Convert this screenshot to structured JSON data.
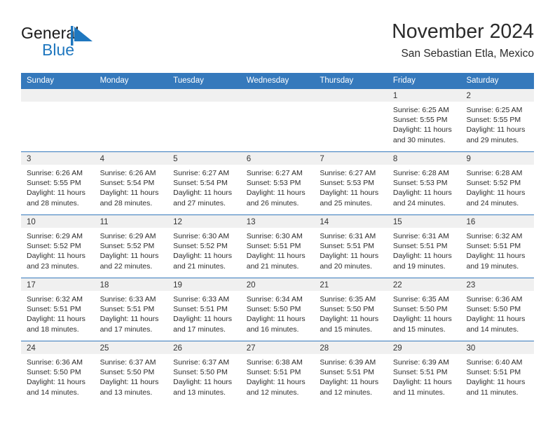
{
  "brand": {
    "name_part1": "General",
    "name_part2": "Blue",
    "accent_color": "#1f77bf"
  },
  "header": {
    "month_title": "November 2024",
    "location": "San Sebastian Etla, Mexico"
  },
  "calendar": {
    "header_color": "#3579bc",
    "weekdays": [
      "Sunday",
      "Monday",
      "Tuesday",
      "Wednesday",
      "Thursday",
      "Friday",
      "Saturday"
    ],
    "weeks": [
      [
        {
          "day": "",
          "sunrise": "",
          "sunset": "",
          "daylight": "",
          "daylight2": ""
        },
        {
          "day": "",
          "sunrise": "",
          "sunset": "",
          "daylight": "",
          "daylight2": ""
        },
        {
          "day": "",
          "sunrise": "",
          "sunset": "",
          "daylight": "",
          "daylight2": ""
        },
        {
          "day": "",
          "sunrise": "",
          "sunset": "",
          "daylight": "",
          "daylight2": ""
        },
        {
          "day": "",
          "sunrise": "",
          "sunset": "",
          "daylight": "",
          "daylight2": ""
        },
        {
          "day": "1",
          "sunrise": "Sunrise: 6:25 AM",
          "sunset": "Sunset: 5:55 PM",
          "daylight": "Daylight: 11 hours",
          "daylight2": "and 30 minutes."
        },
        {
          "day": "2",
          "sunrise": "Sunrise: 6:25 AM",
          "sunset": "Sunset: 5:55 PM",
          "daylight": "Daylight: 11 hours",
          "daylight2": "and 29 minutes."
        }
      ],
      [
        {
          "day": "3",
          "sunrise": "Sunrise: 6:26 AM",
          "sunset": "Sunset: 5:55 PM",
          "daylight": "Daylight: 11 hours",
          "daylight2": "and 28 minutes."
        },
        {
          "day": "4",
          "sunrise": "Sunrise: 6:26 AM",
          "sunset": "Sunset: 5:54 PM",
          "daylight": "Daylight: 11 hours",
          "daylight2": "and 28 minutes."
        },
        {
          "day": "5",
          "sunrise": "Sunrise: 6:27 AM",
          "sunset": "Sunset: 5:54 PM",
          "daylight": "Daylight: 11 hours",
          "daylight2": "and 27 minutes."
        },
        {
          "day": "6",
          "sunrise": "Sunrise: 6:27 AM",
          "sunset": "Sunset: 5:53 PM",
          "daylight": "Daylight: 11 hours",
          "daylight2": "and 26 minutes."
        },
        {
          "day": "7",
          "sunrise": "Sunrise: 6:27 AM",
          "sunset": "Sunset: 5:53 PM",
          "daylight": "Daylight: 11 hours",
          "daylight2": "and 25 minutes."
        },
        {
          "day": "8",
          "sunrise": "Sunrise: 6:28 AM",
          "sunset": "Sunset: 5:53 PM",
          "daylight": "Daylight: 11 hours",
          "daylight2": "and 24 minutes."
        },
        {
          "day": "9",
          "sunrise": "Sunrise: 6:28 AM",
          "sunset": "Sunset: 5:52 PM",
          "daylight": "Daylight: 11 hours",
          "daylight2": "and 24 minutes."
        }
      ],
      [
        {
          "day": "10",
          "sunrise": "Sunrise: 6:29 AM",
          "sunset": "Sunset: 5:52 PM",
          "daylight": "Daylight: 11 hours",
          "daylight2": "and 23 minutes."
        },
        {
          "day": "11",
          "sunrise": "Sunrise: 6:29 AM",
          "sunset": "Sunset: 5:52 PM",
          "daylight": "Daylight: 11 hours",
          "daylight2": "and 22 minutes."
        },
        {
          "day": "12",
          "sunrise": "Sunrise: 6:30 AM",
          "sunset": "Sunset: 5:52 PM",
          "daylight": "Daylight: 11 hours",
          "daylight2": "and 21 minutes."
        },
        {
          "day": "13",
          "sunrise": "Sunrise: 6:30 AM",
          "sunset": "Sunset: 5:51 PM",
          "daylight": "Daylight: 11 hours",
          "daylight2": "and 21 minutes."
        },
        {
          "day": "14",
          "sunrise": "Sunrise: 6:31 AM",
          "sunset": "Sunset: 5:51 PM",
          "daylight": "Daylight: 11 hours",
          "daylight2": "and 20 minutes."
        },
        {
          "day": "15",
          "sunrise": "Sunrise: 6:31 AM",
          "sunset": "Sunset: 5:51 PM",
          "daylight": "Daylight: 11 hours",
          "daylight2": "and 19 minutes."
        },
        {
          "day": "16",
          "sunrise": "Sunrise: 6:32 AM",
          "sunset": "Sunset: 5:51 PM",
          "daylight": "Daylight: 11 hours",
          "daylight2": "and 19 minutes."
        }
      ],
      [
        {
          "day": "17",
          "sunrise": "Sunrise: 6:32 AM",
          "sunset": "Sunset: 5:51 PM",
          "daylight": "Daylight: 11 hours",
          "daylight2": "and 18 minutes."
        },
        {
          "day": "18",
          "sunrise": "Sunrise: 6:33 AM",
          "sunset": "Sunset: 5:51 PM",
          "daylight": "Daylight: 11 hours",
          "daylight2": "and 17 minutes."
        },
        {
          "day": "19",
          "sunrise": "Sunrise: 6:33 AM",
          "sunset": "Sunset: 5:51 PM",
          "daylight": "Daylight: 11 hours",
          "daylight2": "and 17 minutes."
        },
        {
          "day": "20",
          "sunrise": "Sunrise: 6:34 AM",
          "sunset": "Sunset: 5:50 PM",
          "daylight": "Daylight: 11 hours",
          "daylight2": "and 16 minutes."
        },
        {
          "day": "21",
          "sunrise": "Sunrise: 6:35 AM",
          "sunset": "Sunset: 5:50 PM",
          "daylight": "Daylight: 11 hours",
          "daylight2": "and 15 minutes."
        },
        {
          "day": "22",
          "sunrise": "Sunrise: 6:35 AM",
          "sunset": "Sunset: 5:50 PM",
          "daylight": "Daylight: 11 hours",
          "daylight2": "and 15 minutes."
        },
        {
          "day": "23",
          "sunrise": "Sunrise: 6:36 AM",
          "sunset": "Sunset: 5:50 PM",
          "daylight": "Daylight: 11 hours",
          "daylight2": "and 14 minutes."
        }
      ],
      [
        {
          "day": "24",
          "sunrise": "Sunrise: 6:36 AM",
          "sunset": "Sunset: 5:50 PM",
          "daylight": "Daylight: 11 hours",
          "daylight2": "and 14 minutes."
        },
        {
          "day": "25",
          "sunrise": "Sunrise: 6:37 AM",
          "sunset": "Sunset: 5:50 PM",
          "daylight": "Daylight: 11 hours",
          "daylight2": "and 13 minutes."
        },
        {
          "day": "26",
          "sunrise": "Sunrise: 6:37 AM",
          "sunset": "Sunset: 5:50 PM",
          "daylight": "Daylight: 11 hours",
          "daylight2": "and 13 minutes."
        },
        {
          "day": "27",
          "sunrise": "Sunrise: 6:38 AM",
          "sunset": "Sunset: 5:51 PM",
          "daylight": "Daylight: 11 hours",
          "daylight2": "and 12 minutes."
        },
        {
          "day": "28",
          "sunrise": "Sunrise: 6:39 AM",
          "sunset": "Sunset: 5:51 PM",
          "daylight": "Daylight: 11 hours",
          "daylight2": "and 12 minutes."
        },
        {
          "day": "29",
          "sunrise": "Sunrise: 6:39 AM",
          "sunset": "Sunset: 5:51 PM",
          "daylight": "Daylight: 11 hours",
          "daylight2": "and 11 minutes."
        },
        {
          "day": "30",
          "sunrise": "Sunrise: 6:40 AM",
          "sunset": "Sunset: 5:51 PM",
          "daylight": "Daylight: 11 hours",
          "daylight2": "and 11 minutes."
        }
      ]
    ]
  }
}
